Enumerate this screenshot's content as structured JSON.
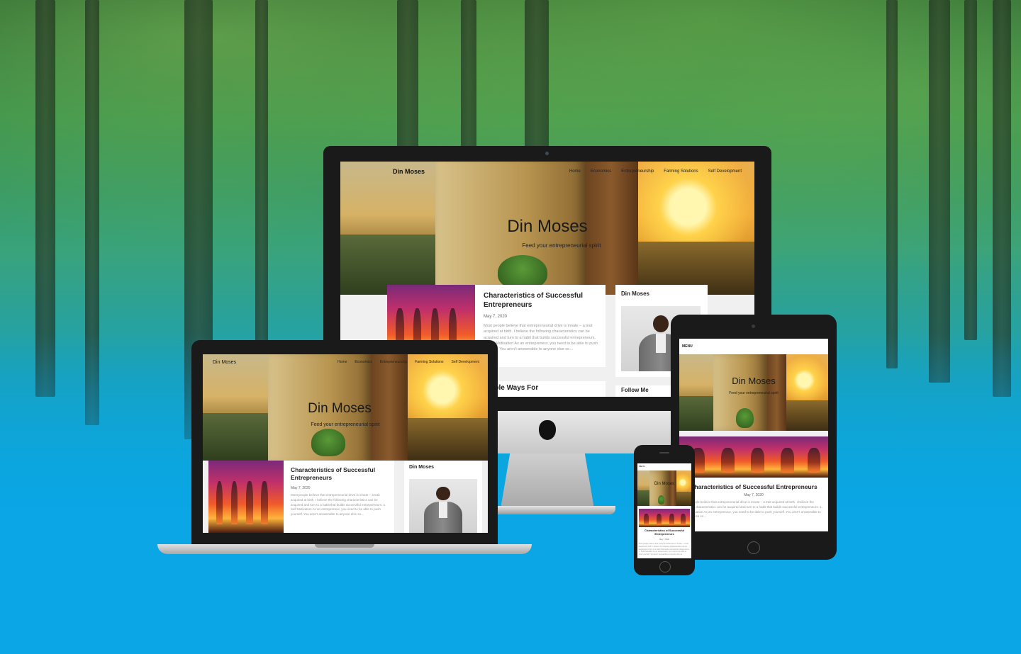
{
  "site": {
    "brand": "Din Moses",
    "nav": [
      "Home",
      "Economics",
      "Entrepreneurship",
      "Farming Solutions",
      "Self Development"
    ],
    "hero_title": "Din Moses",
    "hero_subtitle": "Feed your entrepreneurial spirit",
    "menu_label": "MENU"
  },
  "post": {
    "title": "Characteristics of Successful Entrepreneurs",
    "title_line1": "Characteristics of Successful",
    "title_line2": "Entrepreneurs",
    "date": "May 7, 2020",
    "excerpt": "Most people believe that entrepreneurial drive is innate – a trait acquired at birth. I believe the following characteristics can be acquired and turn to a habit that builds successful entrepreneurs. 1. Self Motivation As an entrepreneur, you need to be able to push yourself. You aren’t answerable to anyone else so…"
  },
  "second_post_title": "sonable Ways For",
  "follow_label": "Follow Me",
  "sidebar_name": "Din Moses",
  "devices": {
    "desktop": "desktop-monitor",
    "laptop": "laptop",
    "tablet": "tablet",
    "phone": "phone"
  },
  "colors": {
    "sky_blue": "#0aa6e6",
    "forest_green": "#2f8a4a",
    "device_black": "#1a1a1a"
  }
}
